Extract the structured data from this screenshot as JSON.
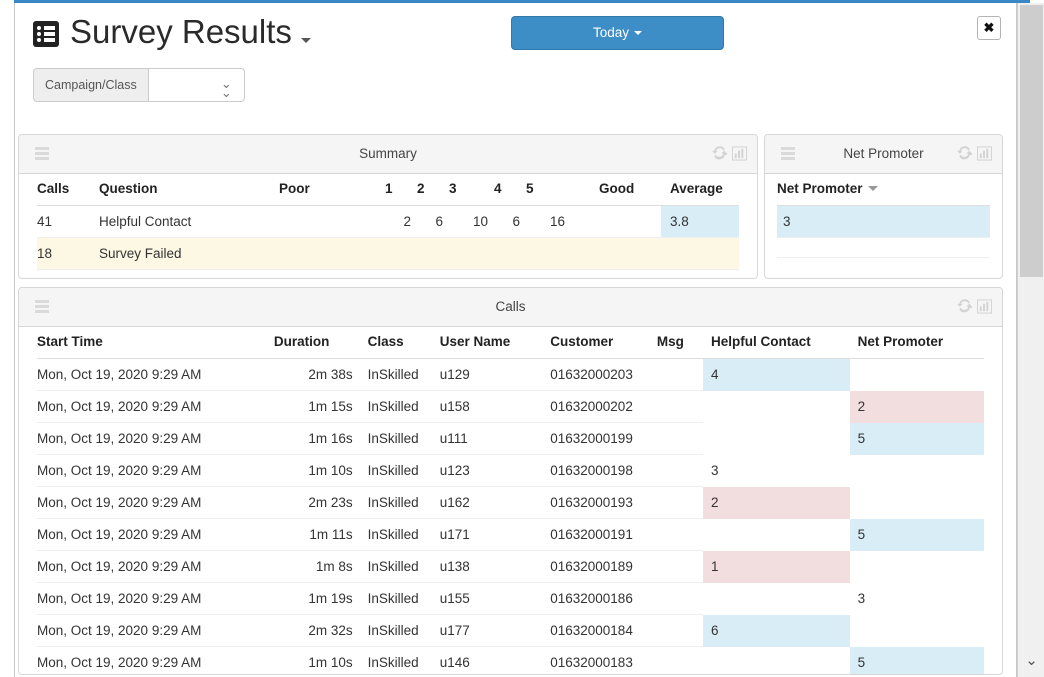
{
  "header": {
    "title": "Survey Results",
    "title_icon": "list-icon",
    "title_caret": "caret-down-icon",
    "today_label": "Today",
    "close_label": "✖"
  },
  "filter": {
    "addon_label": "Campaign/Class",
    "value": "",
    "placeholder": "",
    "chevron_icon": "chevron-double-down-icon"
  },
  "panel_icons": {
    "burger": "hamburger-icon",
    "refresh": "refresh-icon",
    "chart": "bar-chart-icon"
  },
  "summary": {
    "panel_title": "Summary",
    "columns": [
      "Calls",
      "Question",
      "Poor",
      "1",
      "2",
      "3",
      "4",
      "5",
      "Good",
      "Average"
    ],
    "rows": [
      {
        "calls": "41",
        "question": "Helpful Contact",
        "poor": "",
        "r1": "2",
        "r2": "6",
        "r3": "10",
        "r4": "6",
        "r5": "16",
        "good": "",
        "average": "3.8",
        "average_highlight": "blue",
        "row_style": "normal"
      },
      {
        "calls": "18",
        "question": "Survey Failed",
        "poor": "",
        "r1": "",
        "r2": "",
        "r3": "",
        "r4": "",
        "r5": "",
        "good": "",
        "average": "",
        "average_highlight": "none",
        "row_style": "warning"
      }
    ]
  },
  "net_promoter": {
    "panel_title": "Net Promoter",
    "column": "Net Promoter",
    "sort_icon": "caret-down-icon",
    "rows": [
      {
        "value": "3",
        "highlight": "blue"
      },
      {
        "value": "",
        "highlight": "none"
      }
    ]
  },
  "calls": {
    "panel_title": "Calls",
    "columns": [
      "Start Time",
      "Duration",
      "Class",
      "User Name",
      "Customer",
      "Msg",
      "Helpful Contact",
      "Net Promoter"
    ],
    "rows": [
      {
        "start_time": "Mon, Oct 19, 2020 9:29 AM",
        "duration": "2m 38s",
        "class": "InSkilled",
        "user_name": "u129",
        "customer": "01632000203",
        "msg": "",
        "helpful_contact": "4",
        "helpful_highlight": "blue",
        "net_promoter": "",
        "np_highlight": "none"
      },
      {
        "start_time": "Mon, Oct 19, 2020 9:29 AM",
        "duration": "1m 15s",
        "class": "InSkilled",
        "user_name": "u158",
        "customer": "01632000202",
        "msg": "",
        "helpful_contact": "",
        "helpful_highlight": "none",
        "net_promoter": "2",
        "np_highlight": "pink"
      },
      {
        "start_time": "Mon, Oct 19, 2020 9:29 AM",
        "duration": "1m 16s",
        "class": "InSkilled",
        "user_name": "u111",
        "customer": "01632000199",
        "msg": "",
        "helpful_contact": "",
        "helpful_highlight": "none",
        "net_promoter": "5",
        "np_highlight": "blue"
      },
      {
        "start_time": "Mon, Oct 19, 2020 9:29 AM",
        "duration": "1m 10s",
        "class": "InSkilled",
        "user_name": "u123",
        "customer": "01632000198",
        "msg": "",
        "helpful_contact": "3",
        "helpful_highlight": "none",
        "net_promoter": "",
        "np_highlight": "none"
      },
      {
        "start_time": "Mon, Oct 19, 2020 9:29 AM",
        "duration": "2m 23s",
        "class": "InSkilled",
        "user_name": "u162",
        "customer": "01632000193",
        "msg": "",
        "helpful_contact": "2",
        "helpful_highlight": "pink",
        "net_promoter": "",
        "np_highlight": "none"
      },
      {
        "start_time": "Mon, Oct 19, 2020 9:29 AM",
        "duration": "1m 11s",
        "class": "InSkilled",
        "user_name": "u171",
        "customer": "01632000191",
        "msg": "",
        "helpful_contact": "",
        "helpful_highlight": "none",
        "net_promoter": "5",
        "np_highlight": "blue"
      },
      {
        "start_time": "Mon, Oct 19, 2020 9:29 AM",
        "duration": "1m 8s",
        "class": "InSkilled",
        "user_name": "u138",
        "customer": "01632000189",
        "msg": "",
        "helpful_contact": "1",
        "helpful_highlight": "pink",
        "net_promoter": "",
        "np_highlight": "none"
      },
      {
        "start_time": "Mon, Oct 19, 2020 9:29 AM",
        "duration": "1m 19s",
        "class": "InSkilled",
        "user_name": "u155",
        "customer": "01632000186",
        "msg": "",
        "helpful_contact": "",
        "helpful_highlight": "none",
        "net_promoter": "3",
        "np_highlight": "none"
      },
      {
        "start_time": "Mon, Oct 19, 2020 9:29 AM",
        "duration": "2m 32s",
        "class": "InSkilled",
        "user_name": "u177",
        "customer": "01632000184",
        "msg": "",
        "helpful_contact": "6",
        "helpful_highlight": "blue",
        "net_promoter": "",
        "np_highlight": "none"
      },
      {
        "start_time": "Mon, Oct 19, 2020 9:29 AM",
        "duration": "1m 10s",
        "class": "InSkilled",
        "user_name": "u146",
        "customer": "01632000183",
        "msg": "",
        "helpful_contact": "",
        "helpful_highlight": "none",
        "net_promoter": "5",
        "np_highlight": "blue"
      }
    ]
  },
  "scrollbar": {
    "down_arrow": "chevron-down-icon"
  },
  "colors": {
    "accent": "#3d8dc6",
    "link": "#337ab7",
    "highlight_blue": "#d9edf7",
    "highlight_pink": "#f2dede",
    "row_warning": "#fcf8e3"
  }
}
